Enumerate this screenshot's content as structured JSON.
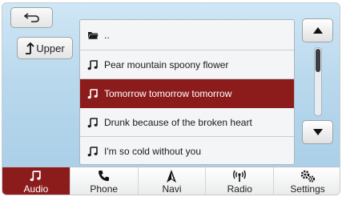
{
  "nav": {
    "back_icon": "back-arrow-icon",
    "upper_label": "Upper",
    "upper_icon": "up-arrow-icon"
  },
  "browser": {
    "folder_label": "..",
    "selected_index": 1,
    "items": [
      {
        "title": "Pear mountain spoony flower"
      },
      {
        "title": "Tomorrow tomorrow tomorrow"
      },
      {
        "title": "Drunk because of the broken heart"
      },
      {
        "title": "I'm so cold without you"
      }
    ]
  },
  "scroll": {
    "position_fraction": 0.0,
    "visible_fraction": 0.35
  },
  "tabs": [
    {
      "label": "Audio",
      "icon": "music-note-icon",
      "active": true
    },
    {
      "label": "Phone",
      "icon": "phone-icon",
      "active": false
    },
    {
      "label": "Navi",
      "icon": "navigation-icon",
      "active": false
    },
    {
      "label": "Radio",
      "icon": "radio-antenna-icon",
      "active": false
    },
    {
      "label": "Settings",
      "icon": "gears-icon",
      "active": false
    }
  ],
  "colors": {
    "accent": "#8c1c1c",
    "background": "#b7d7ec"
  }
}
